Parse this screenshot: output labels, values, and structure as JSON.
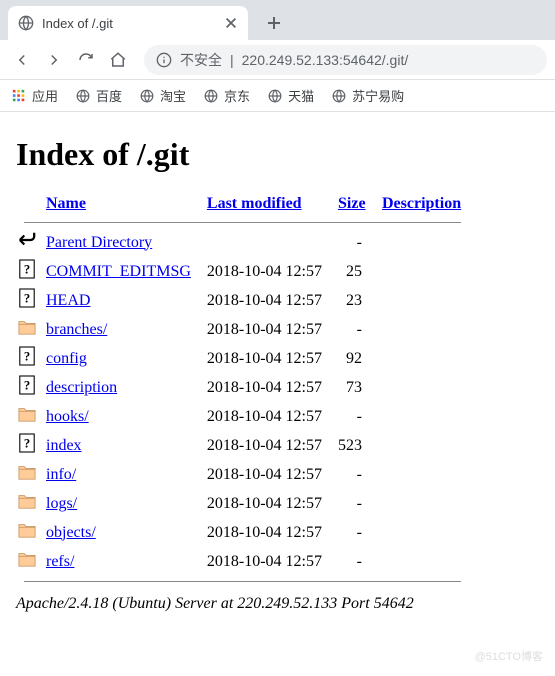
{
  "browser": {
    "tab_title": "Index of /.git",
    "insecure_label": "不安全",
    "url_display": "220.249.52.133:54642/.git/",
    "bookmarks": {
      "apps": "应用",
      "items": [
        "百度",
        "淘宝",
        "京东",
        "天猫",
        "苏宁易购"
      ]
    }
  },
  "page": {
    "heading": "Index of /.git",
    "columns": {
      "name": "Name",
      "modified": "Last modified",
      "size": "Size",
      "description": "Description"
    },
    "parent": {
      "name": "Parent Directory",
      "size": "-"
    },
    "entries": [
      {
        "type": "file",
        "name": "COMMIT_EDITMSG",
        "modified": "2018-10-04 12:57",
        "size": "25"
      },
      {
        "type": "file",
        "name": "HEAD",
        "modified": "2018-10-04 12:57",
        "size": "23"
      },
      {
        "type": "dir",
        "name": "branches/",
        "modified": "2018-10-04 12:57",
        "size": "-"
      },
      {
        "type": "file",
        "name": "config",
        "modified": "2018-10-04 12:57",
        "size": "92"
      },
      {
        "type": "file",
        "name": "description",
        "modified": "2018-10-04 12:57",
        "size": "73"
      },
      {
        "type": "dir",
        "name": "hooks/",
        "modified": "2018-10-04 12:57",
        "size": "-"
      },
      {
        "type": "file",
        "name": "index",
        "modified": "2018-10-04 12:57",
        "size": "523"
      },
      {
        "type": "dir",
        "name": "info/",
        "modified": "2018-10-04 12:57",
        "size": "-"
      },
      {
        "type": "dir",
        "name": "logs/",
        "modified": "2018-10-04 12:57",
        "size": "-"
      },
      {
        "type": "dir",
        "name": "objects/",
        "modified": "2018-10-04 12:57",
        "size": "-"
      },
      {
        "type": "dir",
        "name": "refs/",
        "modified": "2018-10-04 12:57",
        "size": "-"
      }
    ],
    "footer": "Apache/2.4.18 (Ubuntu) Server at 220.249.52.133 Port 54642"
  },
  "watermark": "@51CTO博客"
}
